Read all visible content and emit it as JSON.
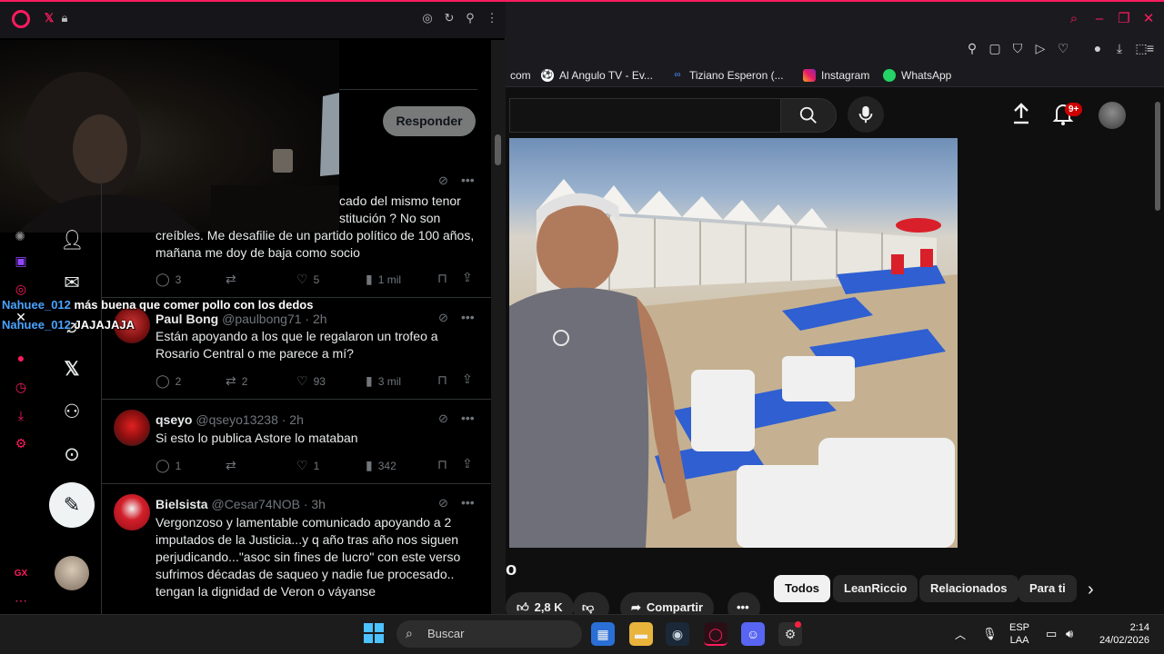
{
  "browser": {
    "bookmarks": [
      {
        "label": "com",
        "icon": "none"
      },
      {
        "label": "Al Angulo TV - Ev...",
        "icon": "soccer-ball-icon"
      },
      {
        "label": "Tiziano Esperon (...",
        "icon": "meta-icon"
      },
      {
        "label": "Instagram",
        "icon": "instagram-icon"
      },
      {
        "label": "WhatsApp",
        "icon": "whatsapp-icon"
      }
    ]
  },
  "youtube": {
    "notification_badge": "9+",
    "title_fragment": "o",
    "actions": {
      "likes": "2,8 K",
      "share": "Compartir"
    },
    "chips": [
      "Todos",
      "LeanRiccio",
      "Relacionados",
      "Para ti"
    ]
  },
  "x_panel": {
    "reply_button": "Responder",
    "tweets": [
      {
        "name": "",
        "handle": "",
        "text_lines": [
          "cado del mismo tenor",
          "stitución ? No son",
          "creíbles. Me desafilie de un partido político de 100 años,",
          "mañana me doy de baja como socio"
        ],
        "replies": "3",
        "retweets": "",
        "likes": "5",
        "views": "1 mil"
      },
      {
        "name": "Paul Bong",
        "handle": "@paulbong71 · 2h",
        "text_lines": [
          "Están apoyando a los que le regalaron un trofeo a",
          "Rosario Central o me parece a mí?"
        ],
        "replies": "2",
        "retweets": "2",
        "likes": "93",
        "views": "3 mil"
      },
      {
        "name": "qseyo",
        "handle": "@qseyo13238 · 2h",
        "text_lines": [
          "Si esto lo publica Astore lo mataban"
        ],
        "replies": "1",
        "retweets": "",
        "likes": "1",
        "views": "342"
      },
      {
        "name": "Bielsista",
        "handle": "@Cesar74NOB · 3h",
        "text_lines": [
          "Vergonzoso y lamentable comunicado apoyando a 2",
          "imputados de la Justicia...y q año tras año nos siguen",
          "perjudicando...\"asoc sin fines de lucro\" con este verso",
          "sufrimos décadas de saqueo y nadie fue procesado..",
          "tengan la dignidad de Veron o váyanse"
        ],
        "replies": "",
        "retweets": "",
        "likes": "",
        "views": ""
      }
    ]
  },
  "stream_chat": [
    {
      "user": "Nahuee_012",
      "message": "más buena que comer pollo con los dedos"
    },
    {
      "user": "Nahuee_012",
      "message": "JAJAJAJA"
    }
  ],
  "taskbar": {
    "search_placeholder": "Buscar",
    "language": "ESP",
    "layout": "LAA",
    "time": "2:14",
    "date": "24/02/2026"
  },
  "colors": {
    "opera_accent": "#ff1b5e",
    "chat_user": "#4aa3ff",
    "yt_badge": "#cc0000"
  }
}
